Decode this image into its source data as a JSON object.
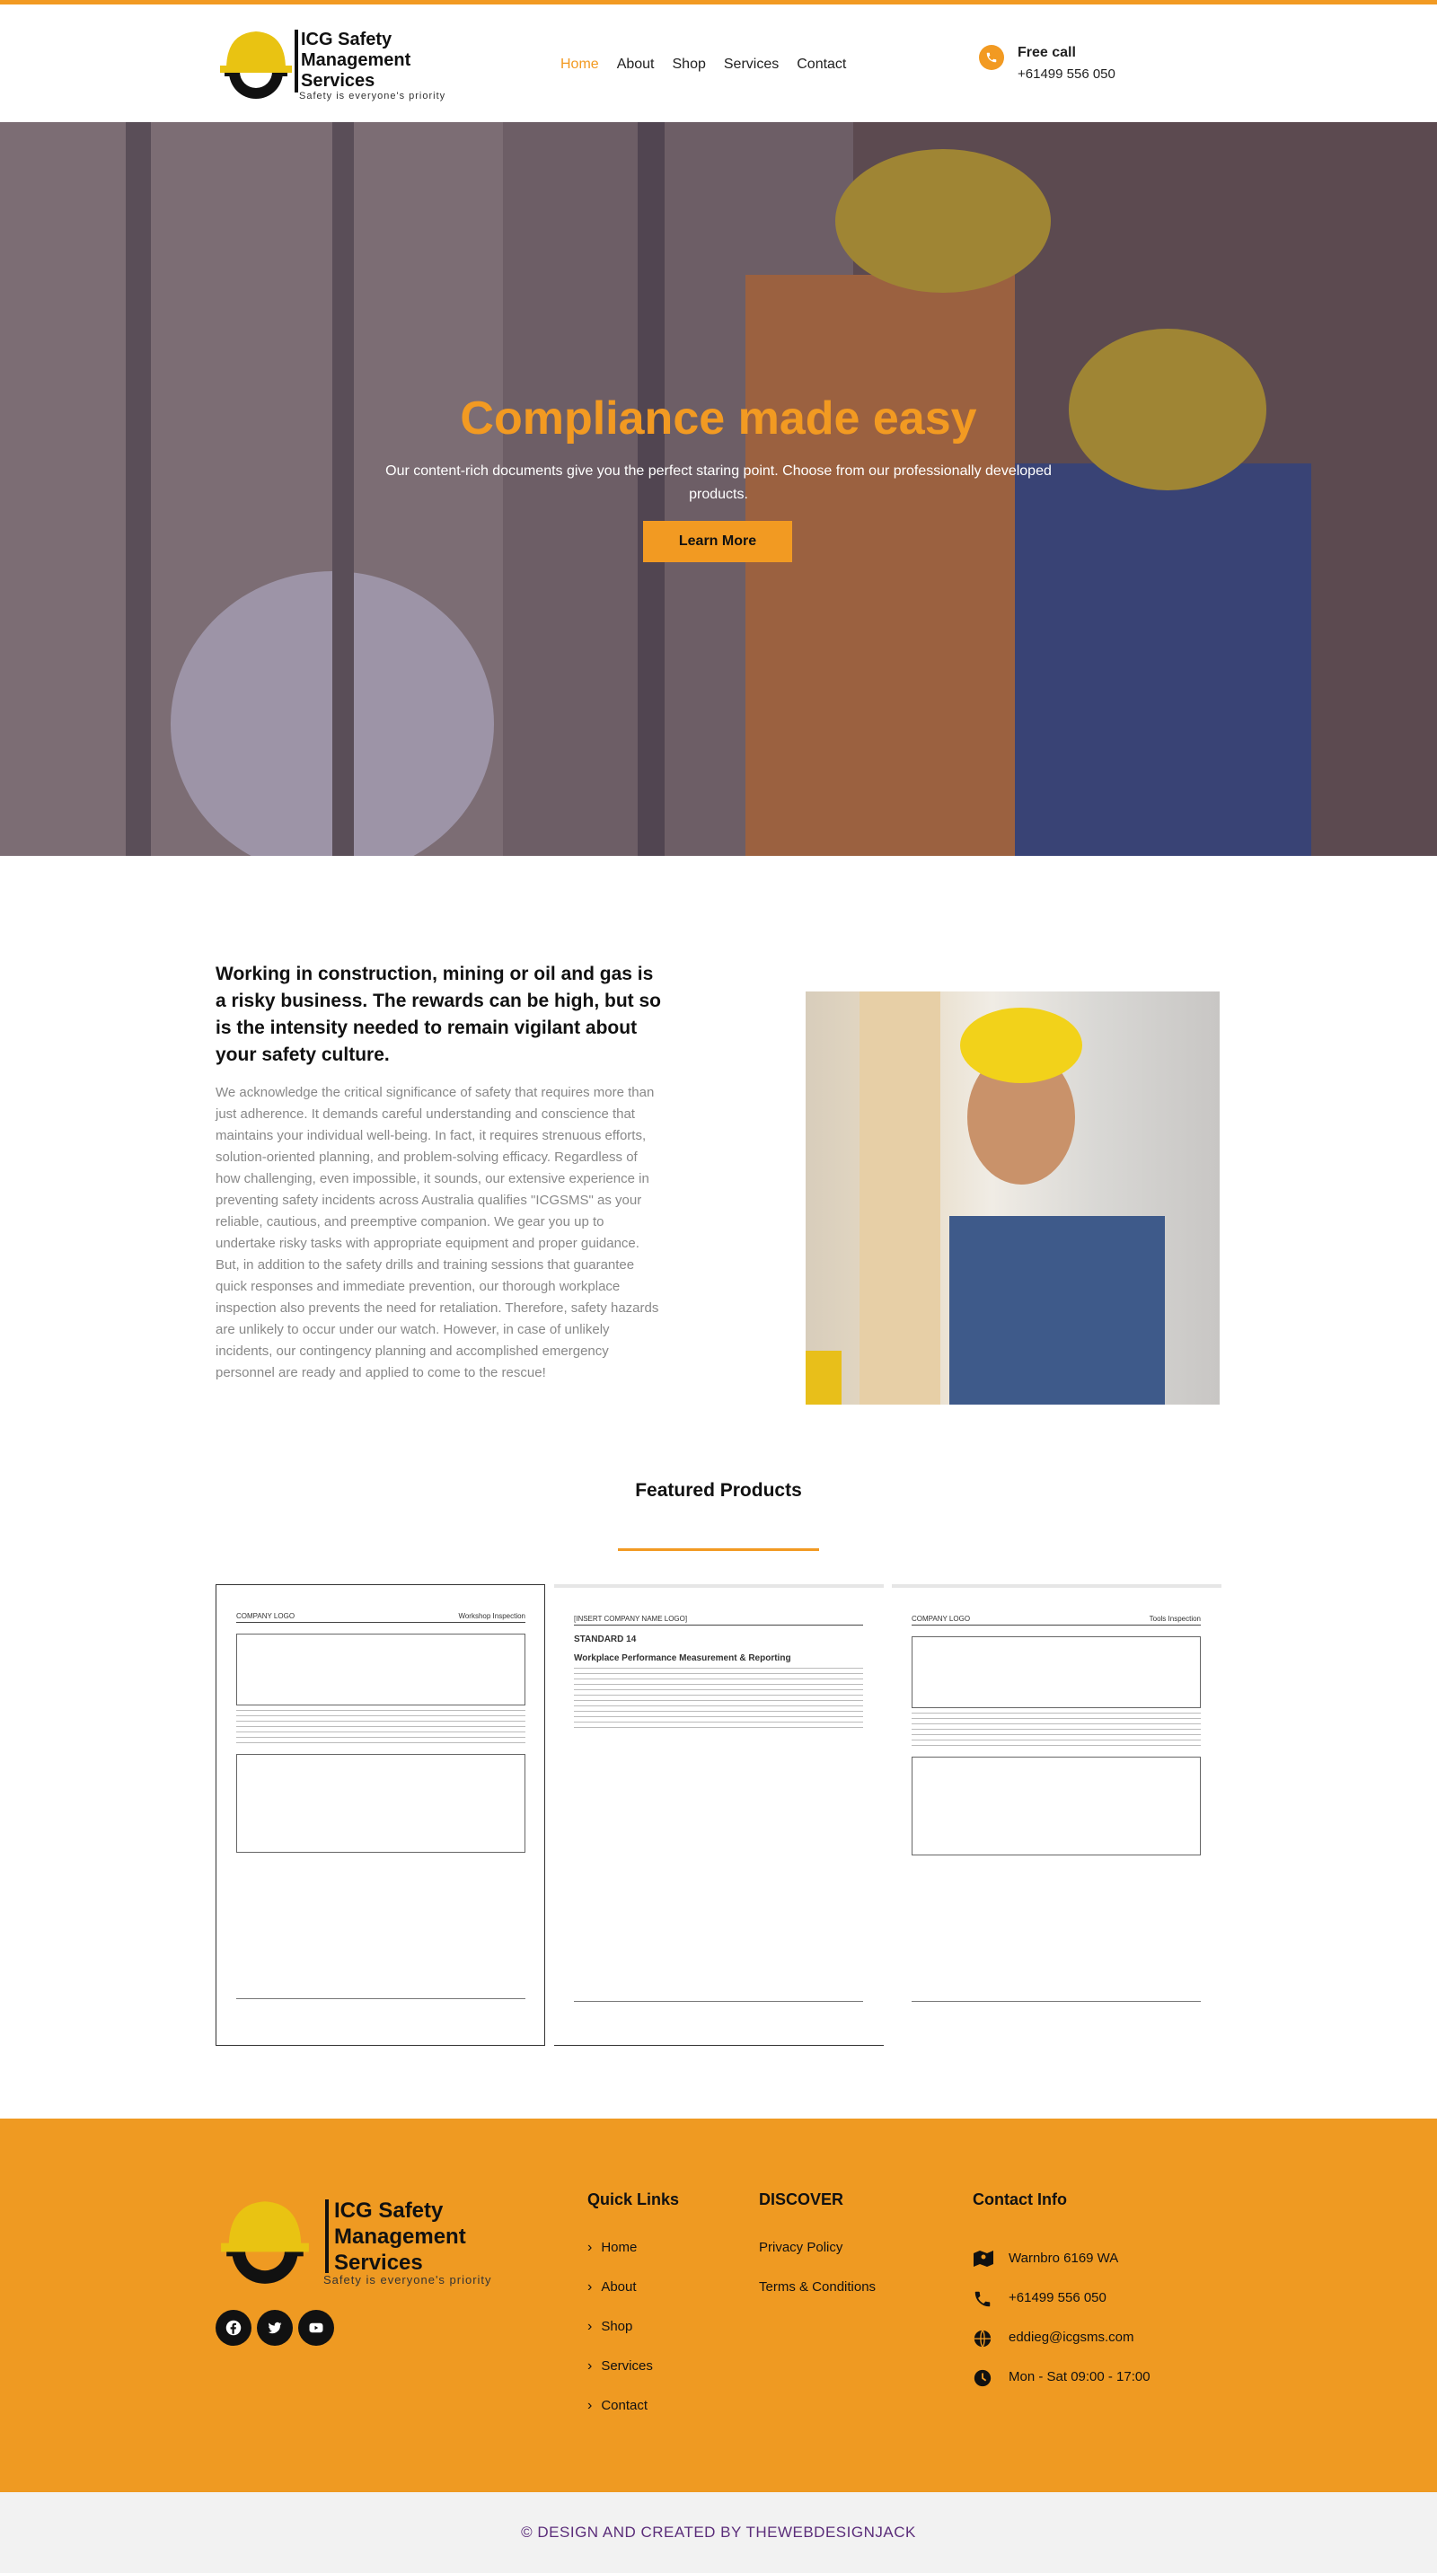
{
  "brand": {
    "name_line1": "ICG Safety",
    "name_line2": "Management",
    "name_line3": "Services",
    "tagline": "Safety is everyone's priority",
    "accent_color": "#f29a22"
  },
  "nav": {
    "items": [
      "Home",
      "About",
      "Shop",
      "Services",
      "Contact"
    ],
    "active": "Home"
  },
  "header_contact": {
    "title": "Free call",
    "phone": "+61499 556 050"
  },
  "hero": {
    "title": "Compliance made easy",
    "subtitle": "Our content-rich documents give you the perfect staring point. Choose from our professionally developed products.",
    "button": "Learn More"
  },
  "intro": {
    "heading": "Working in construction, mining or oil and gas is a risky business. The rewards can be high, but so is the intensity needed to remain vigilant about your safety culture.",
    "body": "We acknowledge the critical significance of safety that requires more than just adherence. It demands careful understanding and conscience that maintains your individual well-being. In fact, it requires strenuous efforts, solution-oriented planning, and problem-solving efficacy. Regardless of how challenging, even impossible, it sounds, our extensive experience in preventing safety incidents across Australia qualifies \"ICGSMS\" as your reliable, cautious, and preemptive companion. We gear you up to undertake risky tasks with appropriate equipment and proper guidance. But, in addition to the safety drills and training sessions that guarantee quick responses and immediate prevention, our thorough workplace inspection also prevents the need for retaliation. Therefore, safety hazards are unlikely to occur under our watch. However, in case of unlikely incidents, our contingency planning and accomplished emergency personnel are ready and applied to come to the rescue!"
  },
  "featured": {
    "title": "Featured Products",
    "products": [
      {
        "logo": "COMPANY LOGO",
        "doc_title": "Workshop Inspection"
      },
      {
        "logo": "[INSERT COMPANY NAME LOGO]",
        "standard": "STANDARD 14",
        "doc_title": "Workplace Performance Measurement & Reporting"
      },
      {
        "logo": "COMPANY LOGO",
        "doc_title": "Tools Inspection"
      }
    ]
  },
  "footer": {
    "quick_links_title": "Quick Links",
    "quick_links": [
      "Home",
      "About",
      "Shop",
      "Services",
      "Contact"
    ],
    "discover_title": "DISCOVER",
    "discover": [
      "Privacy Policy",
      "Terms & Conditions"
    ],
    "contact_title": "Contact Info",
    "contact": [
      {
        "icon": "map-icon",
        "text": "Warnbro 6169 WA"
      },
      {
        "icon": "phone-icon",
        "text": "+61499 556 050"
      },
      {
        "icon": "globe-icon",
        "text": "eddieg@icgsms.com"
      },
      {
        "icon": "clock-icon",
        "text": "Mon - Sat 09:00 - 17:00"
      }
    ],
    "social": [
      "facebook-icon",
      "twitter-icon",
      "youtube-icon"
    ]
  },
  "copyright": "© DESIGN AND CREATED BY THEWEBDESIGNJACK"
}
